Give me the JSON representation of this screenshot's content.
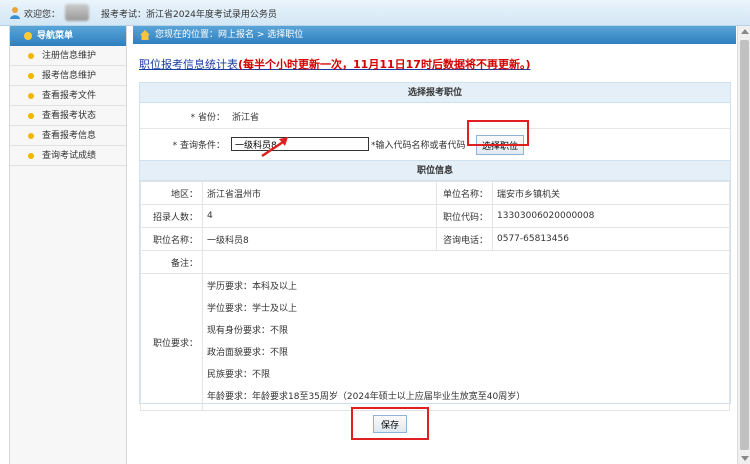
{
  "topbar": {
    "welcome": "欢迎您：",
    "exam": "报考考试：浙江省2024年度考试录用公务员"
  },
  "sidebar": {
    "title": "导航菜单",
    "items": [
      {
        "label": "注册信息维护"
      },
      {
        "label": "报考信息维护"
      },
      {
        "label": "查看报考文件"
      },
      {
        "label": "查看报考状态"
      },
      {
        "label": "查看报考信息"
      },
      {
        "label": "查询考试成绩"
      }
    ]
  },
  "breadcrumb": {
    "text": "您现在的位置：网上报名 > 选择职位"
  },
  "stats": {
    "link": "职位报考信息统计表",
    "note": "(每半个小时更新一次，11月11日17时后数据将不再更新。)"
  },
  "select_panel": {
    "title": "选择报考职位",
    "province_label": "* 省份：",
    "province_value": "浙江省",
    "query_label": "* 查询条件：",
    "query_value": "一级科员8",
    "query_hint": "*输入代码名称或者代码",
    "select_button": "选择职位"
  },
  "info_panel": {
    "title": "职位信息",
    "rows": {
      "region_label": "地区：",
      "region_value": "浙江省温州市",
      "unit_label": "单位名称：",
      "unit_value": "瑞安市乡镇机关",
      "count_label": "招录人数：",
      "count_value": "4",
      "code_label": "职位代码：",
      "code_value": "13303006020000008",
      "name_label": "职位名称：",
      "name_value": "一级科员8",
      "phone_label": "咨询电话：",
      "phone_value": "0577-65813456",
      "remark_label": "备注：",
      "remark_value": "",
      "req_label": "职位要求："
    },
    "requirements": [
      "学历要求：本科及以上",
      "学位要求：学士及以上",
      "现有身份要求：不限",
      "政治面貌要求：不限",
      "民族要求：不限",
      "年龄要求：年龄要求18至35周岁（2024年硕士以上应届毕业生放宽至40周岁）"
    ]
  },
  "save_button": "保存",
  "colors": {
    "nav_blue": "#2f7fc0",
    "link_blue": "#1a3c9e",
    "note_red": "#d50000",
    "highlight_red": "#e02020"
  }
}
